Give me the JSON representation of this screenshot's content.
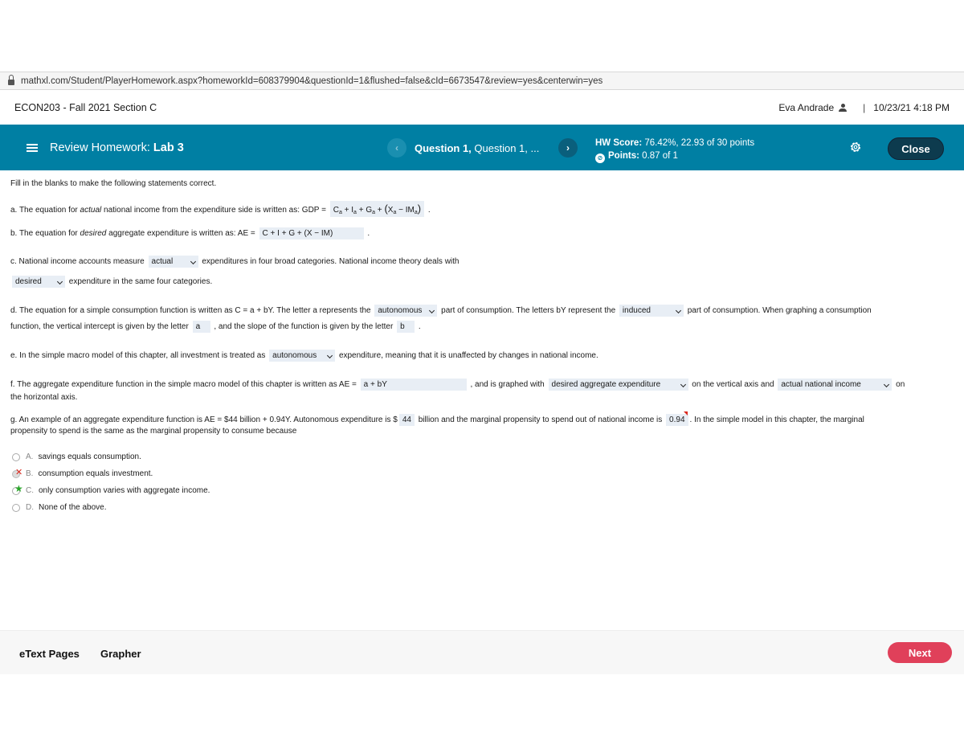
{
  "browser": {
    "url": "mathxl.com/Student/PlayerHomework.aspx?homeworkId=608379904&questionId=1&flushed=false&cId=6673547&review=yes&centerwin=yes"
  },
  "course": {
    "title": "ECON203 - Fall 2021 Section C",
    "user": "Eva Andrade",
    "separator": "|",
    "datetime": "10/23/21 4:18 PM"
  },
  "header": {
    "review_prefix": "Review Homework: ",
    "review_title": "Lab 3",
    "question_bold": "Question 1,",
    "question_rest": " Question 1, ...",
    "hw_score_label": "HW Score:",
    "hw_score_value": " 76.42%, 22.93 of 30 points",
    "points_label": "Points:",
    "points_value": " 0.87 of 1",
    "close_label": "Close",
    "prev_glyph": "‹",
    "next_glyph": "›"
  },
  "question": {
    "intro": "Fill in the blanks to make the following statements correct.",
    "a": {
      "pre1": "a. The equation for ",
      "em": "actual",
      "pre2": " national income from the expenditure side is written as: GDP = ",
      "answer_text": "C",
      "post": "."
    },
    "b": {
      "pre1": "b. The equation for ",
      "em": "desired",
      "pre2": " aggregate expenditure is written as: AE = ",
      "answer": "C + I + G + (X − IM)",
      "post": "."
    },
    "c": {
      "pre": "c. National income accounts measure",
      "drop1": "actual",
      "mid": "expenditures in four broad categories. National income theory deals with",
      "drop2": "desired",
      "post": "expenditure in the same four categories."
    },
    "d": {
      "t1": "d. The equation for a simple consumption function is written as C = a + bY. The letter a represents the",
      "drop1": "autonomous",
      "t2": "part of consumption. The letters bY represent the",
      "drop2": "induced",
      "t3": "part of consumption. When graphing a consumption",
      "t4": "function, the vertical intercept is given by the letter",
      "field1": "a",
      "t5": ", and the slope of the function is given by the letter",
      "field2": "b",
      "t6": "."
    },
    "e": {
      "pre": "e. In the simple macro model of this chapter, all investment is treated as",
      "drop": "autonomous",
      "post": "expenditure, meaning that it is unaffected by changes in national income."
    },
    "f": {
      "t1": "f. The aggregate expenditure function in the simple macro model of this chapter is written as AE =",
      "field": "a + bY",
      "t2": ", and is graphed with",
      "drop1": "desired aggregate expenditure",
      "t3": "on the vertical axis and",
      "drop2": "actual national income",
      "t4": "on",
      "t5": "the horizontal axis."
    },
    "g": {
      "t1": "g. An example of an aggregate expenditure function is AE = $44 billion + 0.94Y. Autonomous expenditure is $",
      "field1": "44",
      "t2": "billion and the marginal propensity to spend out of national income is",
      "field2": "0.94",
      "t3": ". In the simple model in this chapter, the marginal",
      "t4": "propensity to spend is the same as the marginal propensity to consume because"
    },
    "options": [
      {
        "letter": "A.",
        "text": "savings equals consumption.",
        "mark": "none"
      },
      {
        "letter": "B.",
        "text": "consumption equals investment.",
        "mark": "incorrect"
      },
      {
        "letter": "C.",
        "text": "only consumption varies with aggregate income.",
        "mark": "correct"
      },
      {
        "letter": "D.",
        "text": "None of the above.",
        "mark": "none"
      }
    ]
  },
  "footer": {
    "etext_label": "eText Pages",
    "grapher_label": "Grapher",
    "next_label": "Next"
  },
  "colors": {
    "header_bg": "#007fa3",
    "close_bg": "#0d3b4e",
    "next_bg": "#e0405a",
    "field_bg": "#e8eef5"
  }
}
